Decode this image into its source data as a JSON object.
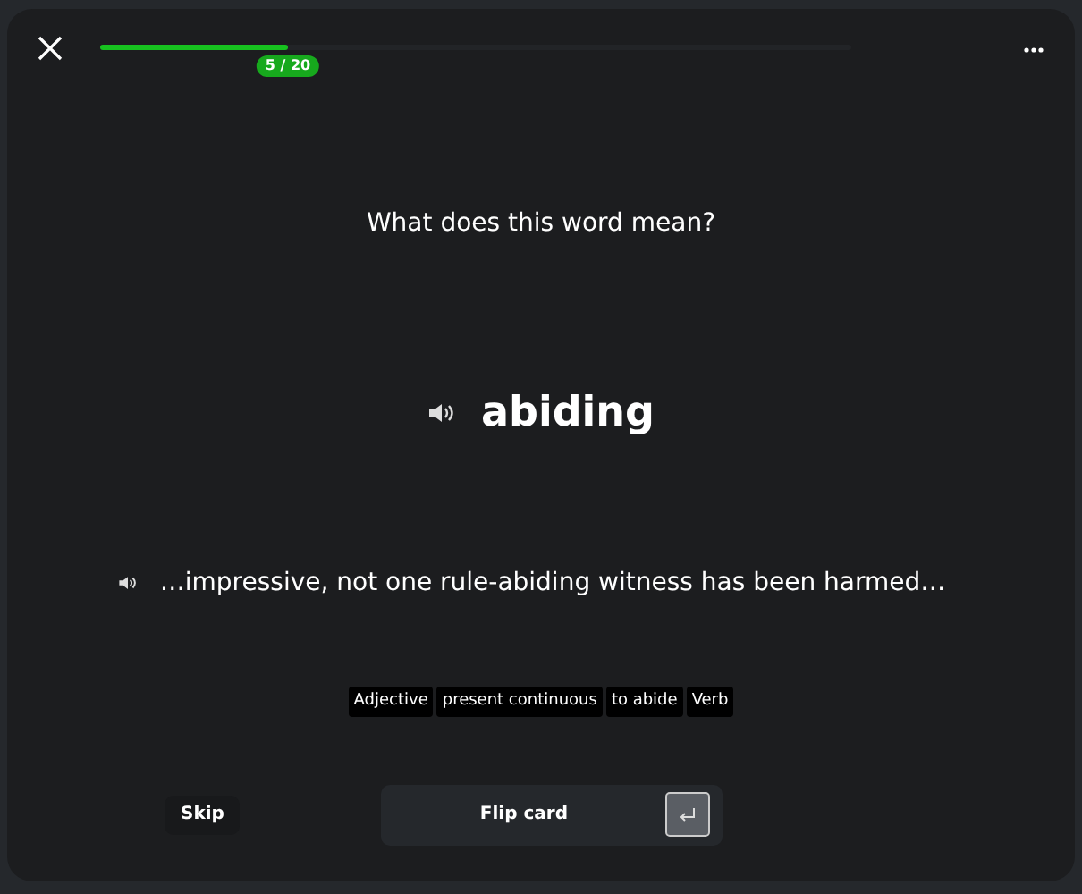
{
  "progress": {
    "level": 0.25,
    "counter": "5 / 20"
  },
  "prompt": "What does this word mean?",
  "word": "abiding",
  "sentence": "…impressive, not one rule-abiding witness has been harmed…",
  "tags": [
    "Adjective",
    "present continuous",
    "to abide",
    "Verb"
  ],
  "skip": "Skip",
  "flip": "Flip card"
}
